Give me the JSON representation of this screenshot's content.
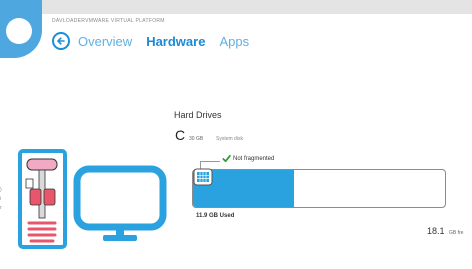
{
  "header": {
    "platform_label": "DAVLOADERVMWARE VIRTUAL PLATFORM",
    "tabs": [
      {
        "label": "Overview",
        "active": false
      },
      {
        "label": "Hardware",
        "active": true
      },
      {
        "label": "Apps",
        "active": false
      }
    ]
  },
  "hard_drives": {
    "title": "Hard Drives",
    "drive": {
      "letter": "C",
      "size": "30 GB",
      "description": "System disk",
      "fragmentation": "Not fragmented",
      "used_label": "11.9 GB Used",
      "free_value": "18.1",
      "free_unit": "GB fre",
      "used_fraction": 0.4
    }
  },
  "edge_marks": [
    ")",
    "i",
    "r"
  ],
  "colors": {
    "accent": "#1b8ad6",
    "bar_fill": "#2aa2e0",
    "tile": "#4fa7e0",
    "check": "#3a9a3a"
  },
  "icons": {
    "back": "back-arrow-icon",
    "check": "checkmark-icon",
    "disk": "disk-grid-icon",
    "hardware": "hardware-illustration-icon"
  }
}
